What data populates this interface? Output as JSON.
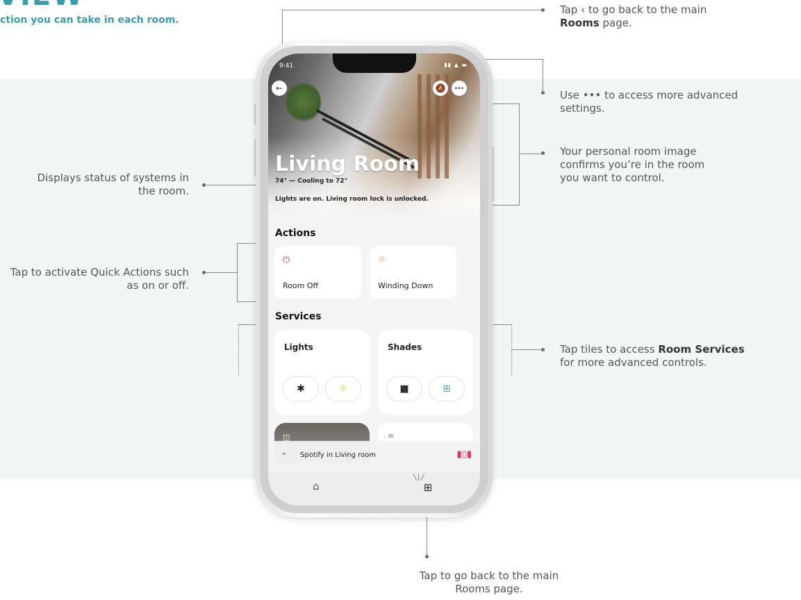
{
  "page": {
    "title_fragment": "VIEW",
    "subtitle": "ction you can take in each room."
  },
  "annotations": {
    "back": {
      "prefix": "Tap ‹ to go back to the main ",
      "bold": "Rooms",
      "suffix": " page."
    },
    "more": "Use ••• to access more advanced settings.",
    "room_image": "Your personal room image confirms you’re in the room you want to control.",
    "status": "Displays status of systems in the room.",
    "quick_actions": "Tap to activate Quick Actions such as on or off.",
    "room_services": {
      "prefix": "Tap tiles to access ",
      "bold": "Room Services",
      "suffix": " for more advanced controls."
    },
    "rooms_tab": "Tap to go back to the main Rooms page."
  },
  "phone": {
    "status_time": "9:41",
    "room_name": "Living Room",
    "temperature": "74° — Cooling to 72°",
    "status_text": "Lights are on. Living room lock is unlocked.",
    "actions_header": "Actions",
    "actions": [
      {
        "label": "Room Off",
        "icon": "power-icon",
        "color": "#d9334a"
      },
      {
        "label": "Winding Down",
        "icon": "bulb-icon",
        "color": "#f0a030"
      }
    ],
    "services_header": "Services",
    "services": [
      {
        "label": "Lights",
        "controls": [
          "light-off-icon",
          "light-on-icon"
        ]
      },
      {
        "label": "Shades",
        "controls": [
          "shade-closed-icon",
          "shade-open-icon"
        ]
      }
    ],
    "mini_player": "Spotify in Living room",
    "accent": "#3a9bab"
  }
}
